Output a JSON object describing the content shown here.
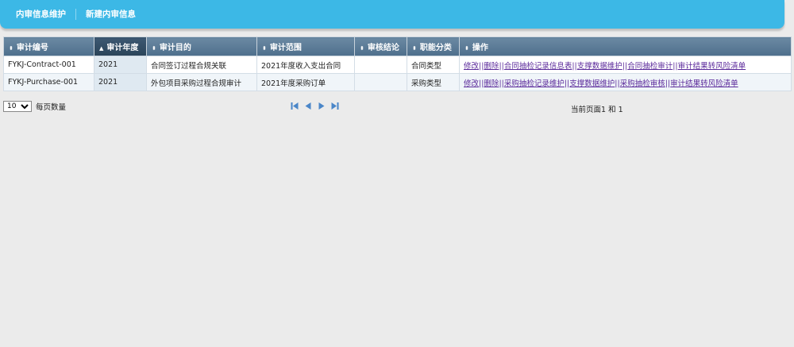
{
  "topbar": {
    "tabs": [
      "内审信息维护",
      "新建内审信息"
    ]
  },
  "table": {
    "headers": [
      "审计编号",
      "审计年度",
      "审计目的",
      "审计范围",
      "审核结论",
      "职能分类",
      "操作"
    ],
    "sorted_column": 1,
    "rows": [
      {
        "id": "FYKJ-Contract-001",
        "year": "2021",
        "purpose": "合同签订过程合规关联",
        "scope": "2021年度收入支出合同",
        "conclusion": "",
        "category": "合同类型",
        "ops": [
          "修改",
          "删除",
          "合同抽检记录信息表",
          "支撑数据维护",
          "合同抽检审计",
          "审计结果转风险清单"
        ]
      },
      {
        "id": "FYKJ-Purchase-001",
        "year": "2021",
        "purpose": "外包项目采购过程合规审计",
        "scope": "2021年度采购订单",
        "conclusion": "",
        "category": "采购类型",
        "ops": [
          "修改",
          "删除",
          "采购抽检记录维护",
          "支撑数据维护",
          "采购抽检审核",
          "审计结果转风险清单"
        ]
      }
    ]
  },
  "pager": {
    "page_size": "10",
    "page_size_label": "每页数量",
    "page_info": "当前页面1 和 1"
  },
  "colors": {
    "topbar": "#3cb8e6",
    "header": "#587a97",
    "link": "#5b2a9b",
    "nav_icon": "#4a86c8"
  }
}
